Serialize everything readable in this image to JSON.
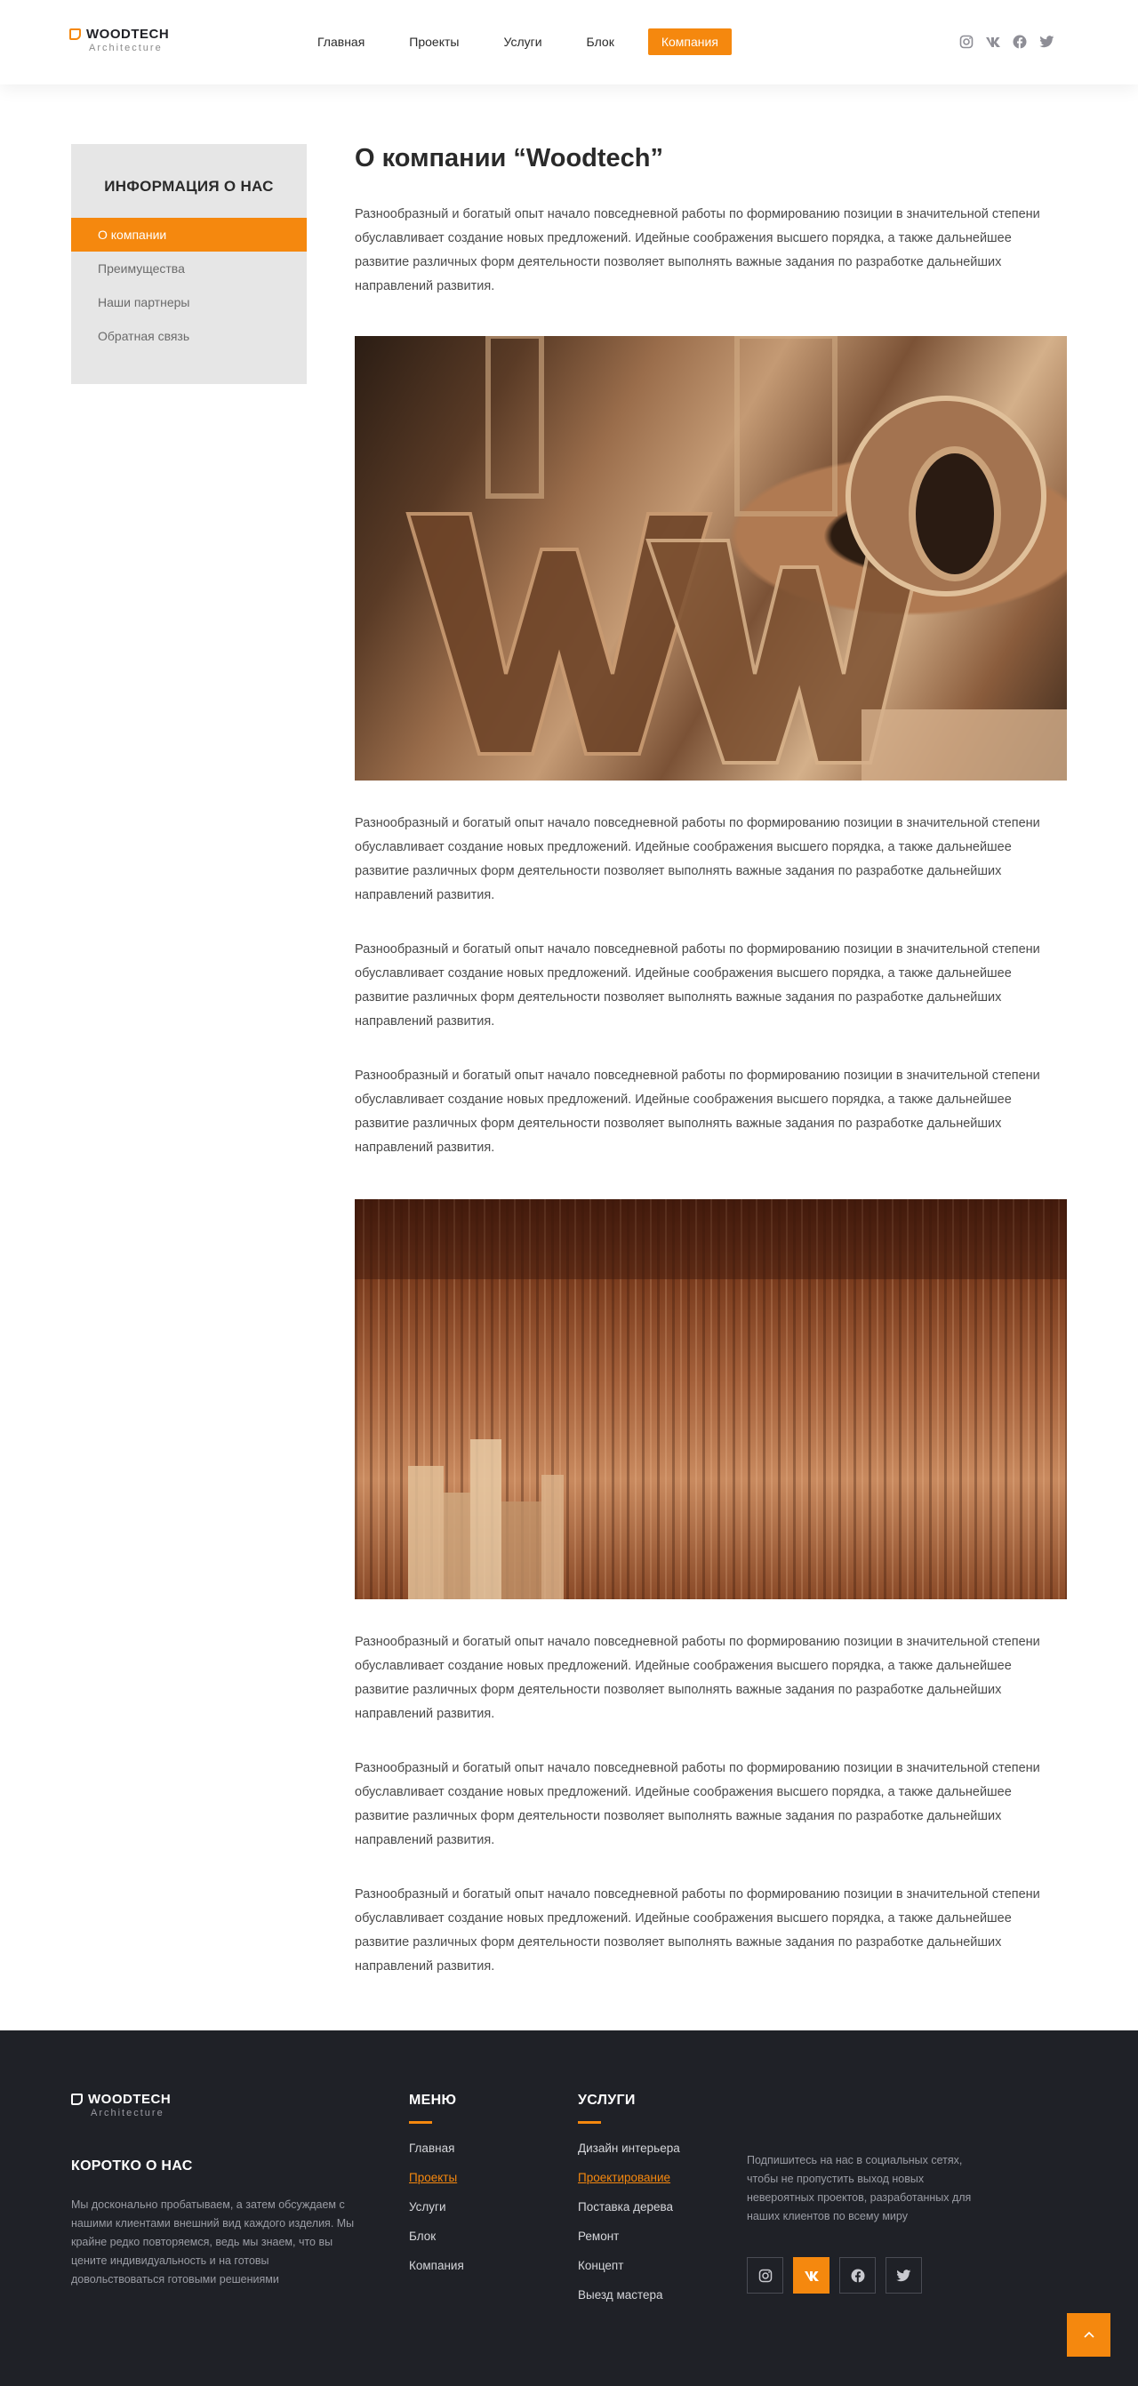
{
  "header": {
    "logo_name": "WOODTECH",
    "logo_sub": "Architecture",
    "nav": [
      "Главная",
      "Проекты",
      "Услуги",
      "Блок",
      "Компания"
    ],
    "social_icons": [
      "instagram-icon",
      "vk-icon",
      "facebook-icon",
      "twitter-icon"
    ]
  },
  "sidebar": {
    "title": "ИНФОРМАЦИЯ О НАС",
    "items": [
      "О компании",
      "Преимущества",
      "Наши партнеры",
      "Обратная связь"
    ]
  },
  "main": {
    "title": "О компании “Woodtech”",
    "paragraph": "Разнообразный и богатый опыт начало повседневной работы по формированию позиции в значительной степени обуславливает создание новых предложений. Идейные соображения высшего порядка, а также дальнейшее развитие различных форм деятельности позволяет выполнять важные задания по разработке дальнейших направлений развития."
  },
  "footer": {
    "logo_name": "WOODTECH",
    "logo_sub": "Architecture",
    "about_title": "КОРОТКО О НАС",
    "about_text": "Мы досконально пробатываем, а затем обсуждаем с нашими клиентами внешний вид каждого изделия. Мы крайне редко повторяемся, ведь мы знаем, что вы цените индивидуальность и на готовы довольствоваться готовыми решениями",
    "menu_title": "МЕНЮ",
    "menu_items": [
      "Главная",
      "Проекты",
      "Услуги",
      "Блок",
      "Компания"
    ],
    "services_title": "УСЛУГИ",
    "services_items": [
      "Дизайн интерьера",
      "Проектирование",
      "Поставка дерева",
      "Ремонт",
      "Концепт",
      "Выезд мастера"
    ],
    "subscribe_text": "Подпишитесь на нас в социальных сетях, чтобы не пропустить выход новых невероятных проектов, разработанных для наших клиентов по всему миру",
    "social_icons": [
      "instagram-icon",
      "vk-icon",
      "facebook-icon",
      "twitter-icon"
    ]
  },
  "colors": {
    "accent": "#f5880e",
    "footer_bg": "#1f2127",
    "sidebar_bg": "#e6e6e6"
  }
}
